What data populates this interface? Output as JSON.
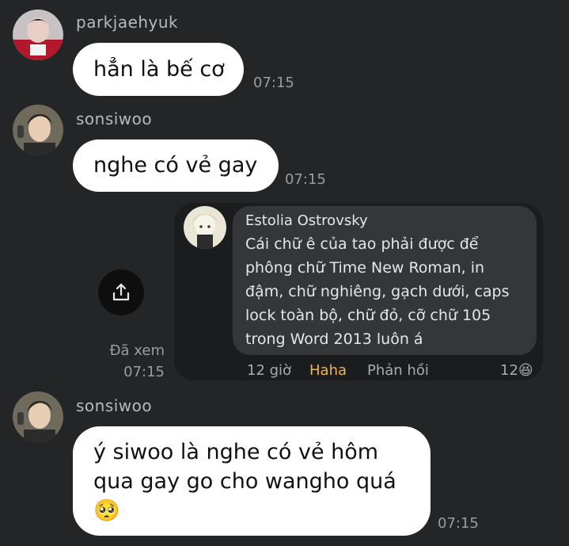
{
  "messages": [
    {
      "user": "parkjaehyuk",
      "text": "hẳn là bế cơ",
      "time": "07:15"
    },
    {
      "user": "sonsiwoo",
      "text": "nghe có vẻ gay",
      "time": "07:15"
    },
    {
      "user": "sonsiwoo",
      "lines": [
        "ý siwoo là nghe có vẻ hôm",
        "qua gay go cho wangho quá",
        "🥺"
      ],
      "time": "07:15"
    }
  ],
  "shared_comment": {
    "author": "Estolia Ostrovsky",
    "lines": [
      "Cái chữ ê của tao phải được để",
      "phông chữ Time New Roman, in",
      "đậm, chữ nghiêng, gạch dưới, caps",
      "lock toàn bộ, chữ đỏ, cỡ chữ 105",
      "trong Word 2013 luôn á"
    ],
    "age": "12 giờ",
    "haha_label": "Haha",
    "reply_label": "Phản hồi",
    "reaction_count": "12",
    "reaction_emoji": "😆"
  },
  "seen": {
    "label": "Đã xem",
    "time": "07:15"
  },
  "icons": {
    "share": "share-icon"
  },
  "colors": {
    "background": "#242526",
    "bubble": "#ffffff",
    "haha": "#f0b453"
  }
}
